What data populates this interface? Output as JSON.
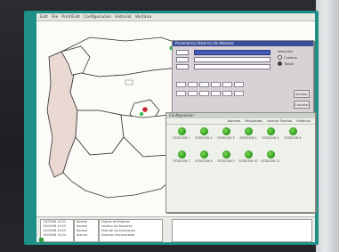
{
  "menubar": {
    "items": [
      "Edit",
      "File",
      "Print/Edit",
      "Configuracion",
      "Historial",
      "Ventana"
    ]
  },
  "dialog_top": {
    "title": "Parametros Historico de Alarmas",
    "radio_group_title": "Seleccion",
    "radio_options": [
      "Cuadros",
      "Tablas"
    ],
    "buttons": [
      "Aceptar",
      "Cancelar"
    ]
  },
  "dialog_bottom": {
    "title": "Configuracion",
    "menu": [
      "Alarmas",
      "Resultados",
      "Lectura Puntual",
      "Historico"
    ],
    "stations": [
      "ESTACION 1",
      "ESTACION 2",
      "ESTACION 3",
      "ESTACION 4",
      "ESTACION 5",
      "ESTACION 6",
      "ESTACION 7",
      "ESTACION 8",
      "ESTACION 9",
      "ESTACION 10",
      "ESTACION 11"
    ]
  },
  "status": {
    "left_lines": [
      "13/05/98 10:21",
      "13/05/98 10:22",
      "13/05/98 10:23",
      "13/05/98 10:24",
      "13/05/98 10:25"
    ],
    "mid_lines": [
      "Normal",
      "Normal",
      "Normal",
      "Alarma",
      "Normal"
    ],
    "right_lines": [
      "Estado de Estacion",
      "Lectura de Sensores",
      "Fallo de Comunicacion",
      "Estacion Reconectada",
      "Estacion Desconectada"
    ]
  },
  "colors": {
    "screen_bg": "#1d8f86",
    "dialog_title_blue": "#3a4e9a",
    "station_green": "#2f9d22",
    "map_highlight": "#ead8d2"
  },
  "icons": {
    "station": "green-sphere-icon",
    "map_marker": "red-dot-icon"
  }
}
